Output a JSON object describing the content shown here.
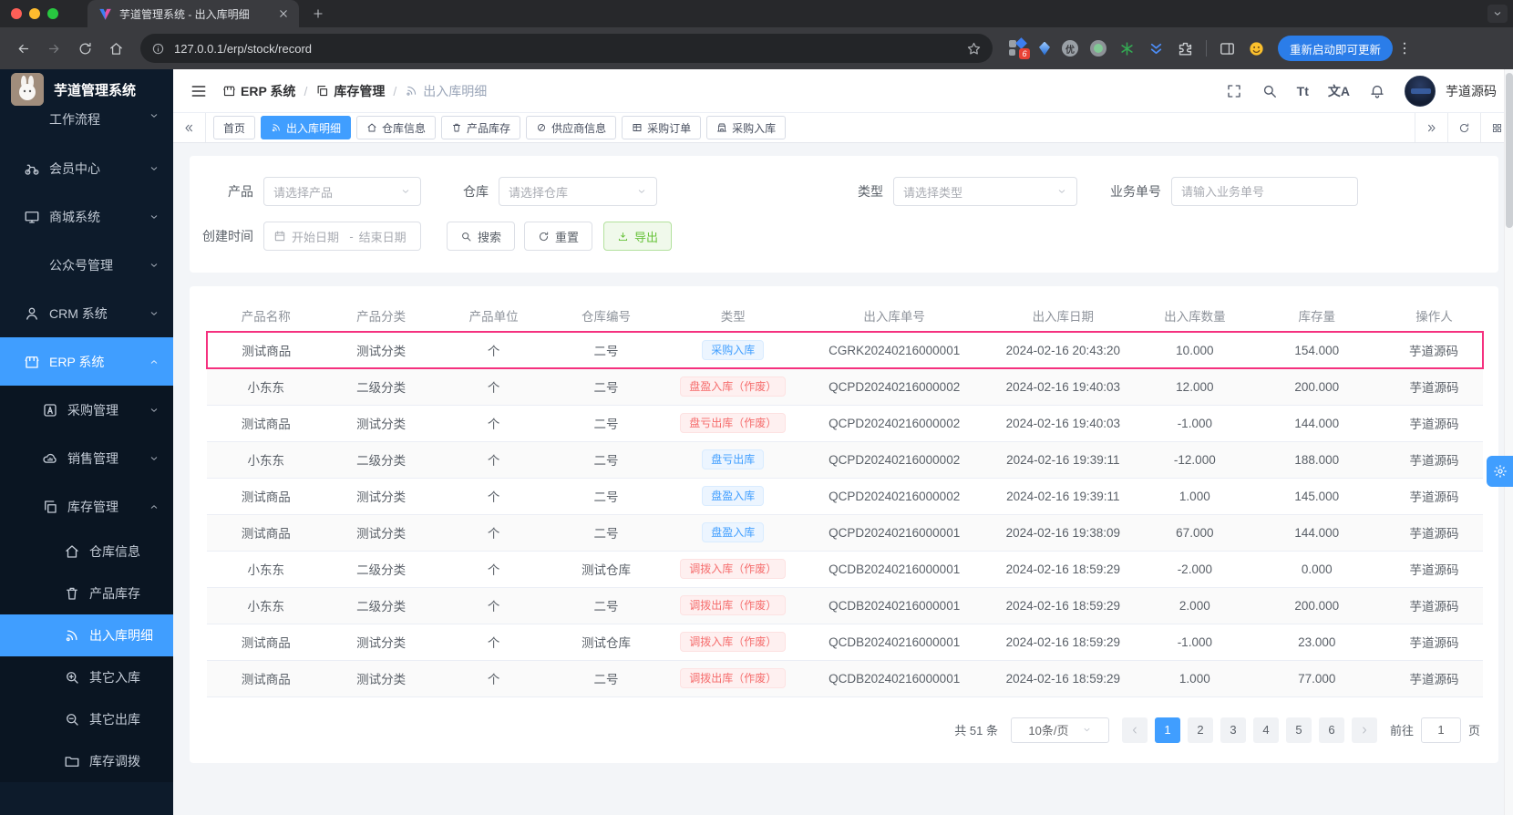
{
  "colors": {
    "accent": "#409eff",
    "success": "#67c23a",
    "danger": "#f56c6c",
    "highlight_row_border": "#f5317f",
    "sidebar_bg": "#0d1b2b"
  },
  "browser": {
    "tab_title": "芋道管理系统 - 出入库明细",
    "url": "127.0.0.1/erp/stock/record",
    "update_button": "重新启动即可更新",
    "extension_badge": "6"
  },
  "sidebar": {
    "logo_title": "芋道管理系统",
    "items": [
      {
        "label": "工作流程",
        "icon": "",
        "level": 1,
        "chevron": "down"
      },
      {
        "label": "会员中心",
        "icon": "bike",
        "level": 1,
        "chevron": "down"
      },
      {
        "label": "商城系统",
        "icon": "display",
        "level": 1,
        "chevron": "down"
      },
      {
        "label": "公众号管理",
        "icon": "",
        "level": 1,
        "chevron": "down"
      },
      {
        "label": "CRM 系统",
        "icon": "user",
        "level": 1,
        "chevron": "down"
      },
      {
        "label": "ERP 系统",
        "icon": "shop",
        "level": 1,
        "chevron": "up",
        "active": true
      },
      {
        "label": "采购管理",
        "icon": "asquare",
        "level": 2,
        "chevron": "down"
      },
      {
        "label": "销售管理",
        "icon": "cloud",
        "level": 2,
        "chevron": "down"
      },
      {
        "label": "库存管理",
        "icon": "copy",
        "level": 2,
        "chevron": "up"
      },
      {
        "label": "仓库信息",
        "icon": "home",
        "level": 3
      },
      {
        "label": "产品库存",
        "icon": "cup",
        "level": 3
      },
      {
        "label": "出入库明细",
        "icon": "send",
        "level": 3,
        "active": true
      },
      {
        "label": "其它入库",
        "icon": "zoomin",
        "level": 3
      },
      {
        "label": "其它出库",
        "icon": "zoomout",
        "level": 3
      },
      {
        "label": "库存调拨",
        "icon": "folder",
        "level": 3
      }
    ]
  },
  "header": {
    "breadcrumb": [
      {
        "label": "ERP 系统",
        "icon": "shop"
      },
      {
        "label": "库存管理",
        "icon": "copy"
      },
      {
        "label": "出入库明细",
        "icon": "send"
      }
    ],
    "font_icon": "Tt",
    "lang_icon": "文A",
    "username": "芋道源码"
  },
  "tags_view": {
    "tabs": [
      {
        "label": "首页",
        "icon": ""
      },
      {
        "label": "出入库明细",
        "icon": "send",
        "active": true
      },
      {
        "label": "仓库信息",
        "icon": "home"
      },
      {
        "label": "产品库存",
        "icon": "cup"
      },
      {
        "label": "供应商信息",
        "icon": "slashcircle"
      },
      {
        "label": "采购订单",
        "icon": "table"
      },
      {
        "label": "采购入库",
        "icon": "building"
      }
    ]
  },
  "filters": {
    "product_label": "产品",
    "product_placeholder": "请选择产品",
    "warehouse_label": "仓库",
    "warehouse_placeholder": "请选择仓库",
    "type_label": "类型",
    "type_placeholder": "请选择类型",
    "bizno_label": "业务单号",
    "bizno_placeholder": "请输入业务单号",
    "date_label": "创建时间",
    "date_start_placeholder": "开始日期",
    "date_separator": "-",
    "date_end_placeholder": "结束日期",
    "search_label": "搜索",
    "reset_label": "重置",
    "export_label": "导出"
  },
  "table": {
    "columns": [
      "产品名称",
      "产品分类",
      "产品单位",
      "仓库编号",
      "类型",
      "出入库单号",
      "出入库日期",
      "出入库数量",
      "库存量",
      "操作人"
    ],
    "rows": [
      {
        "product": "测试商品",
        "category": "测试分类",
        "unit": "个",
        "warehouse": "二号",
        "type": "采购入库",
        "type_color": "blue",
        "order_no": "CGRK20240216000001",
        "date": "2024-02-16 20:43:20",
        "qty": "10.000",
        "stock": "154.000",
        "operator": "芋道源码",
        "highlighted": true
      },
      {
        "product": "小东东",
        "category": "二级分类",
        "unit": "个",
        "warehouse": "二号",
        "type": "盘盈入库（作废）",
        "type_color": "red",
        "order_no": "QCPD20240216000002",
        "date": "2024-02-16 19:40:03",
        "qty": "12.000",
        "stock": "200.000",
        "operator": "芋道源码"
      },
      {
        "product": "测试商品",
        "category": "测试分类",
        "unit": "个",
        "warehouse": "二号",
        "type": "盘亏出库（作废）",
        "type_color": "red",
        "order_no": "QCPD20240216000002",
        "date": "2024-02-16 19:40:03",
        "qty": "-1.000",
        "stock": "144.000",
        "operator": "芋道源码"
      },
      {
        "product": "小东东",
        "category": "二级分类",
        "unit": "个",
        "warehouse": "二号",
        "type": "盘亏出库",
        "type_color": "blue",
        "order_no": "QCPD20240216000002",
        "date": "2024-02-16 19:39:11",
        "qty": "-12.000",
        "stock": "188.000",
        "operator": "芋道源码"
      },
      {
        "product": "测试商品",
        "category": "测试分类",
        "unit": "个",
        "warehouse": "二号",
        "type": "盘盈入库",
        "type_color": "blue",
        "order_no": "QCPD20240216000002",
        "date": "2024-02-16 19:39:11",
        "qty": "1.000",
        "stock": "145.000",
        "operator": "芋道源码"
      },
      {
        "product": "测试商品",
        "category": "测试分类",
        "unit": "个",
        "warehouse": "二号",
        "type": "盘盈入库",
        "type_color": "blue",
        "order_no": "QCPD20240216000001",
        "date": "2024-02-16 19:38:09",
        "qty": "67.000",
        "stock": "144.000",
        "operator": "芋道源码"
      },
      {
        "product": "小东东",
        "category": "二级分类",
        "unit": "个",
        "warehouse": "测试仓库",
        "type": "调拨入库（作废）",
        "type_color": "red",
        "order_no": "QCDB20240216000001",
        "date": "2024-02-16 18:59:29",
        "qty": "-2.000",
        "stock": "0.000",
        "operator": "芋道源码"
      },
      {
        "product": "小东东",
        "category": "二级分类",
        "unit": "个",
        "warehouse": "二号",
        "type": "调拨出库（作废）",
        "type_color": "red",
        "order_no": "QCDB20240216000001",
        "date": "2024-02-16 18:59:29",
        "qty": "2.000",
        "stock": "200.000",
        "operator": "芋道源码"
      },
      {
        "product": "测试商品",
        "category": "测试分类",
        "unit": "个",
        "warehouse": "测试仓库",
        "type": "调拨入库（作废）",
        "type_color": "red",
        "order_no": "QCDB20240216000001",
        "date": "2024-02-16 18:59:29",
        "qty": "-1.000",
        "stock": "23.000",
        "operator": "芋道源码"
      },
      {
        "product": "测试商品",
        "category": "测试分类",
        "unit": "个",
        "warehouse": "二号",
        "type": "调拨出库（作废）",
        "type_color": "red",
        "order_no": "QCDB20240216000001",
        "date": "2024-02-16 18:59:29",
        "qty": "1.000",
        "stock": "77.000",
        "operator": "芋道源码"
      }
    ]
  },
  "pagination": {
    "total_label": "共 51 条",
    "page_size_label": "10条/页",
    "pages": [
      "1",
      "2",
      "3",
      "4",
      "5",
      "6"
    ],
    "active_page": "1",
    "goto_label": "前往",
    "goto_value": "1",
    "goto_suffix": "页"
  }
}
